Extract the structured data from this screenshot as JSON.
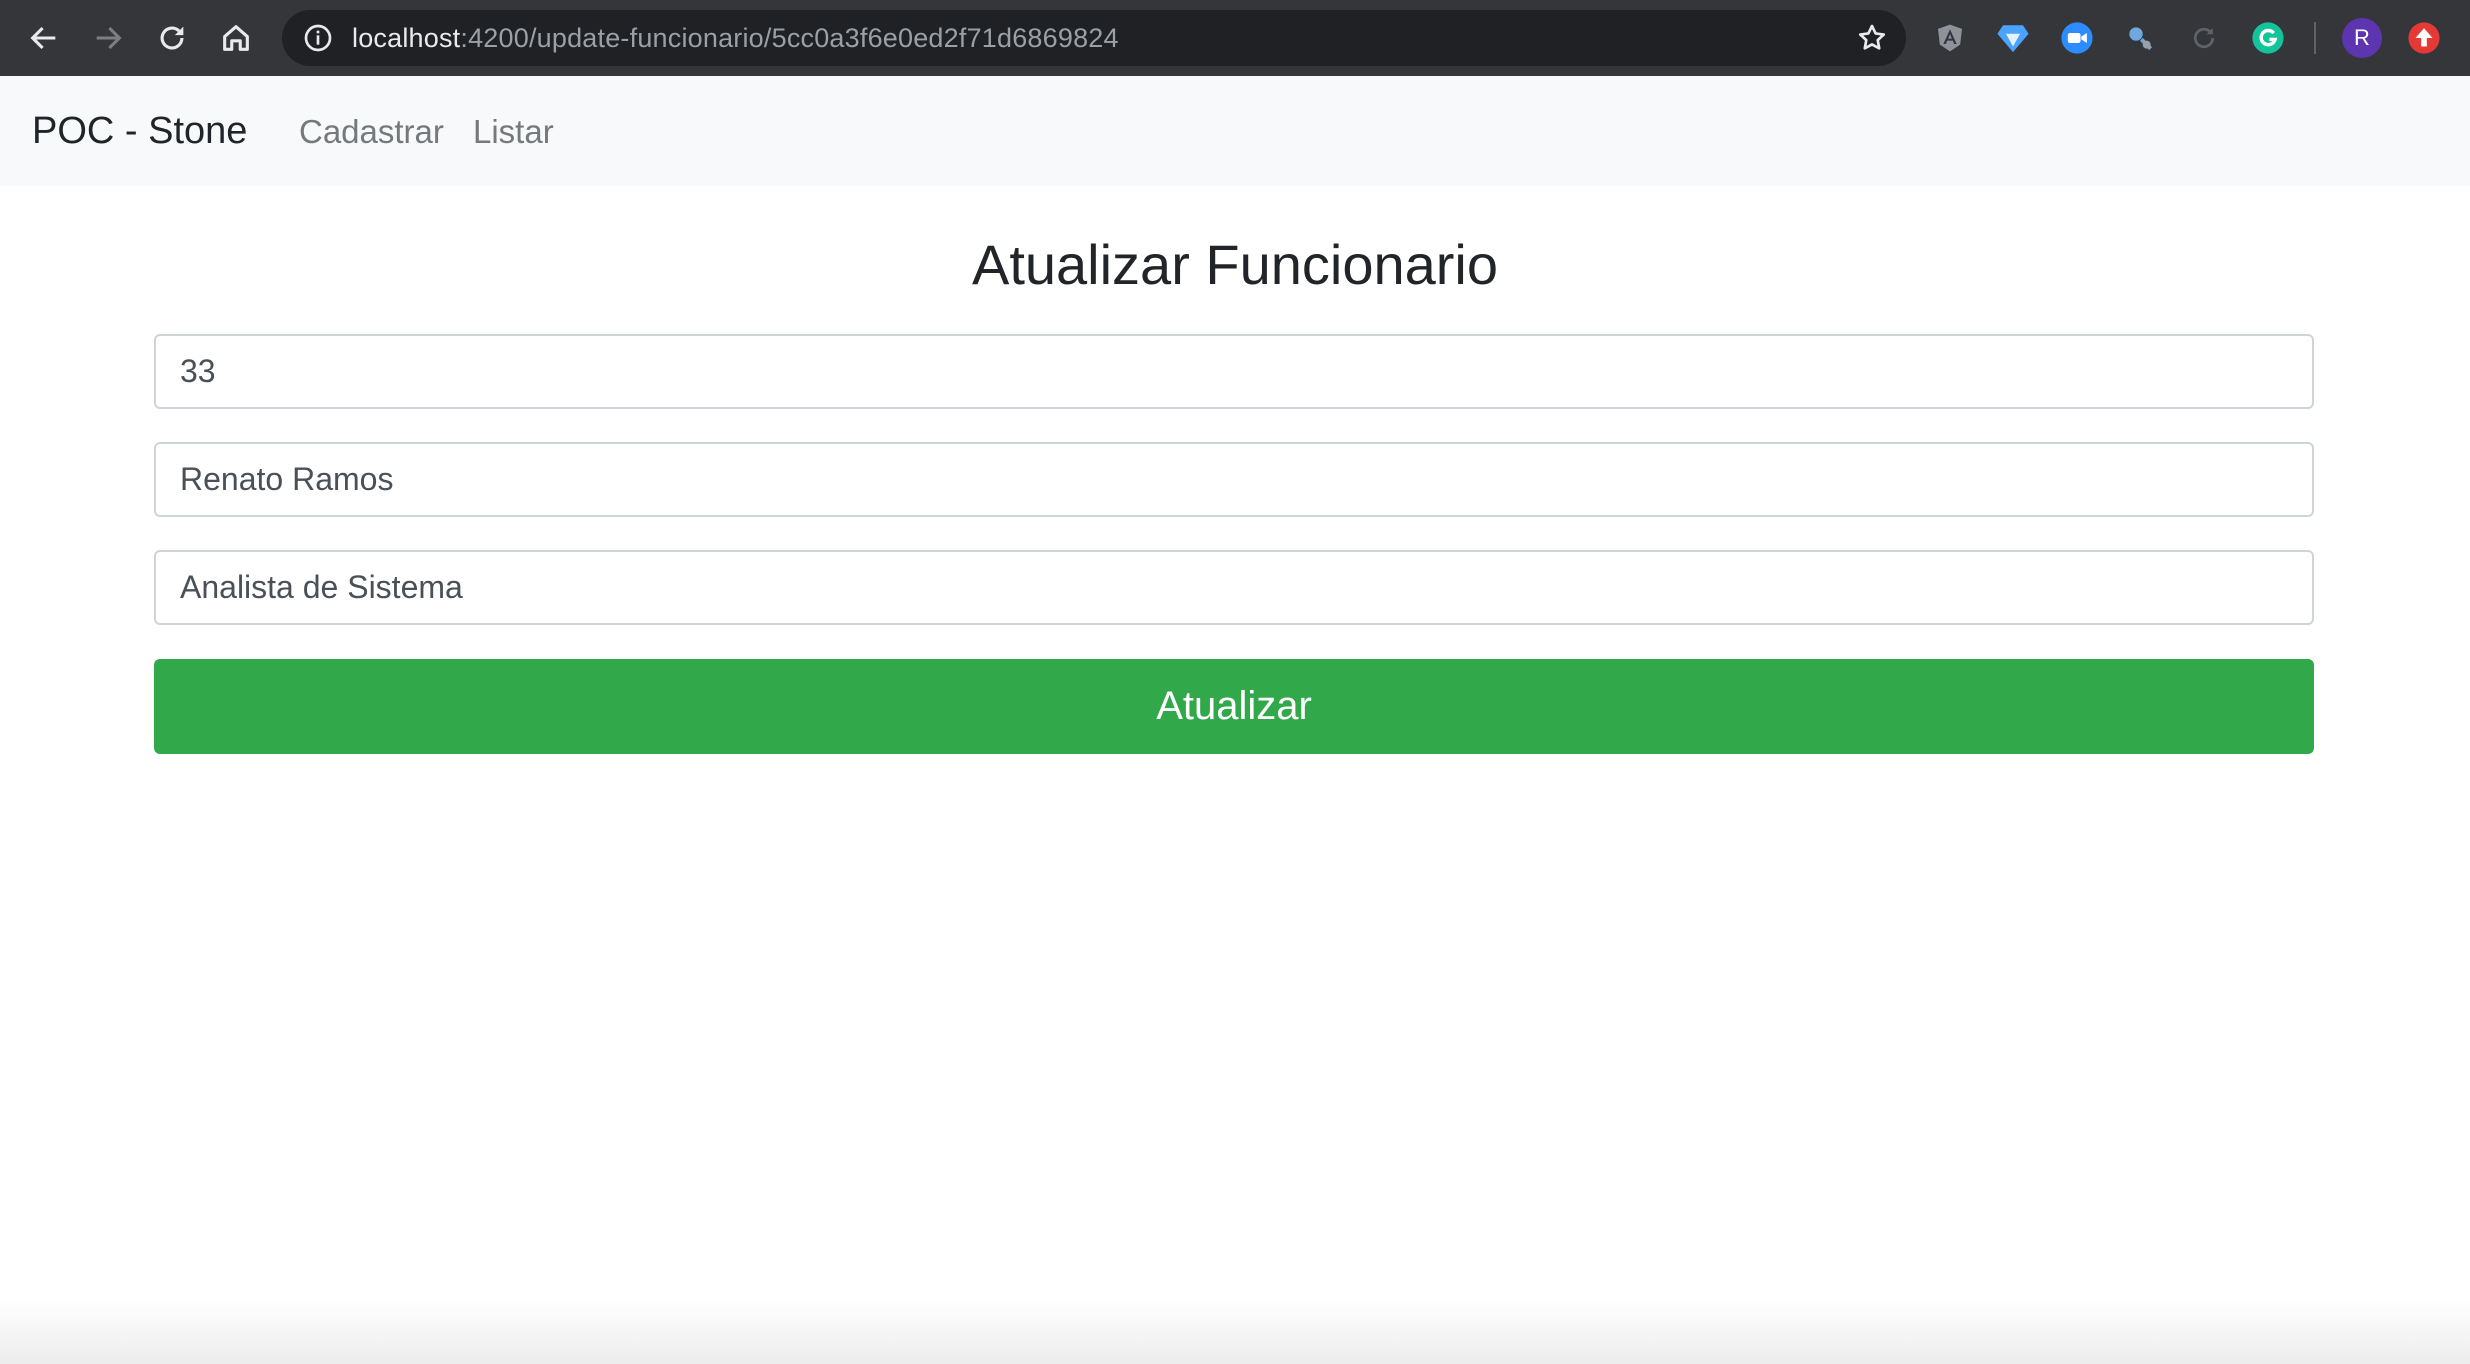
{
  "browser": {
    "url_host": "localhost",
    "url_path": ":4200/update-funcionario/5cc0a3f6e0ed2f71d6869824",
    "profile_initial": "R",
    "icons": {
      "back": "arrow-left-icon",
      "forward": "arrow-right-icon",
      "reload": "reload-icon",
      "home": "home-icon",
      "site_info": "info-icon",
      "bookmark": "star-icon",
      "extensions": [
        "angular-extension-icon",
        "diamond-extension-icon",
        "zoom-extension-icon",
        "magnifier-extension-icon",
        "sync-extension-icon",
        "grammarly-extension-icon",
        "upload-extension-icon"
      ]
    }
  },
  "navbar": {
    "brand": "POC - Stone",
    "links": [
      {
        "label": "Cadastrar"
      },
      {
        "label": "Listar"
      }
    ]
  },
  "form": {
    "title": "Atualizar Funcionario",
    "fields": [
      {
        "value": "33"
      },
      {
        "value": "Renato Ramos"
      },
      {
        "value": "Analista de Sistema"
      }
    ],
    "submit_label": "Atualizar"
  },
  "colors": {
    "chrome_bg": "#35363a",
    "navbar_bg": "#f8f9fa",
    "button_success": "#31a84a",
    "input_border": "#ced4da"
  }
}
